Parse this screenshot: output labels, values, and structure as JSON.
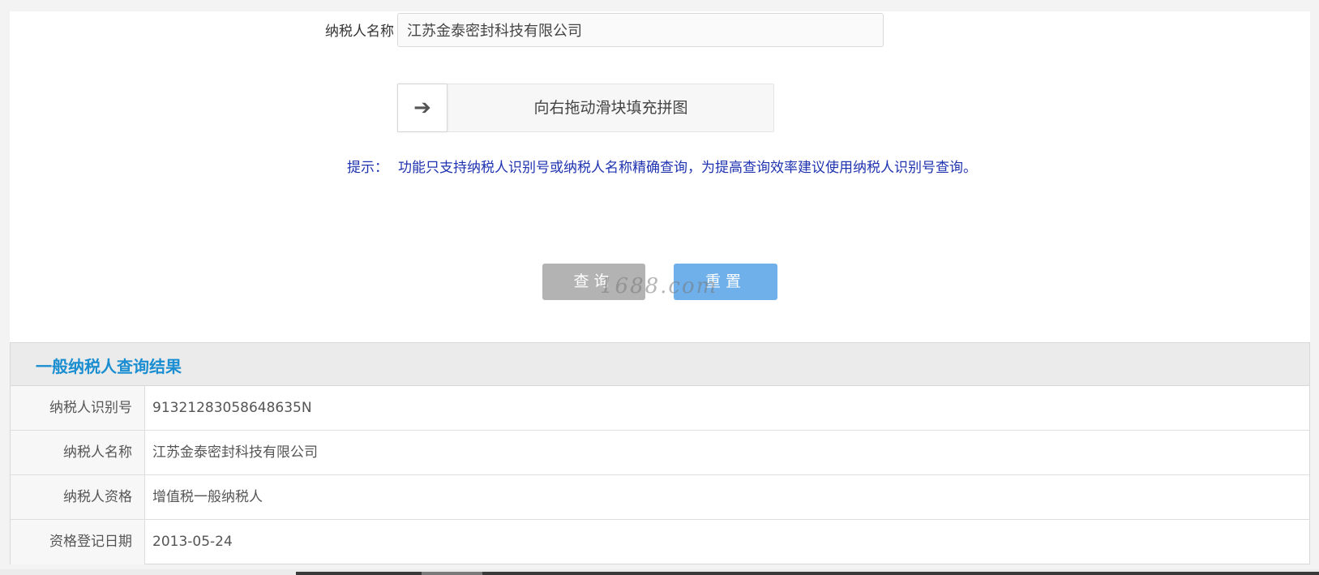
{
  "form": {
    "name_label": "纳税人名称",
    "name_value": "江苏金泰密封科技有限公司"
  },
  "slider": {
    "handle_icon": "arrow-right-icon",
    "handle_glyph": "➔",
    "text": "向右拖动滑块填充拼图"
  },
  "hint": {
    "label": "提示：",
    "text": "功能只支持纳税人识别号或纳税人名称精确查询，为提高查询效率建议使用纳税人识别号查询。"
  },
  "buttons": {
    "query": "查询",
    "reset": "重置"
  },
  "watermark": "1688.com",
  "result": {
    "title": "一般纳税人查询结果",
    "rows": [
      {
        "label": "纳税人识别号",
        "value": "91321283058648635N"
      },
      {
        "label": "纳税人名称",
        "value": "江苏金泰密封科技有限公司"
      },
      {
        "label": "纳税人资格",
        "value": "增值税一般纳税人"
      },
      {
        "label": "资格登记日期",
        "value": "2013-05-24"
      }
    ]
  },
  "colors": {
    "title_blue": "#1a8ed0",
    "hint_blue": "#1f33b0",
    "reset_button": "#6fb0ea",
    "query_button": "#b3b3b3"
  }
}
